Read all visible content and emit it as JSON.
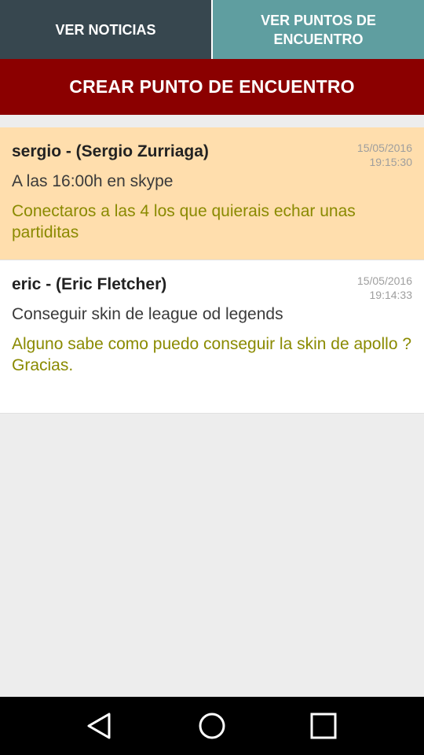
{
  "tabs": {
    "news_label": "VER NOTICIAS",
    "meeting_points_label": "VER PUNTOS DE\nENCUENTRO"
  },
  "create_button": {
    "label": "CREAR PUNTO DE ENCUENTRO"
  },
  "meeting_points": [
    {
      "author": "sergio - (Sergio Zurriaga)",
      "date": "15/05/2016",
      "time": "19:15:30",
      "title": "A las 16:00h en skype",
      "body": "Conectaros a las 4 los que quierais echar unas partiditas"
    },
    {
      "author": "eric - (Eric Fletcher)",
      "date": "15/05/2016",
      "time": "19:14:33",
      "title": "Conseguir skin de league od legends",
      "body": "Alguno sabe como puedo conseguir la skin de apollo ?\nGracias."
    }
  ],
  "navigation_bar": {
    "back_icon": "back-triangle-icon",
    "home_icon": "home-circle-icon",
    "recent_icon": "recent-apps-square-icon"
  },
  "colors": {
    "tab_news_bg": "#37474f",
    "tab_meeting_bg": "#5f9ea0",
    "create_button_bg": "#8b0000",
    "highlighted_item_bg": "#ffdead",
    "body_text": "#8a8a00"
  }
}
